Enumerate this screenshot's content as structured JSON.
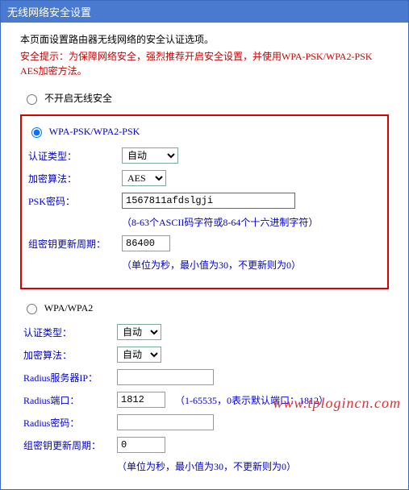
{
  "header": {
    "title": "无线网络安全设置"
  },
  "intro": "本页面设置路由器无线网络的安全认证选项。",
  "warning": "安全提示：为保障网络安全，强烈推荐开启安全设置，并使用WPA-PSK/WPA2-PSK AES加密方法。",
  "noSecurity": {
    "label": "不开启无线安全",
    "checked": false
  },
  "wpaPsk": {
    "label": "WPA-PSK/WPA2-PSK",
    "checked": true,
    "authType": {
      "label": "认证类型：",
      "value": "自动",
      "options": [
        "自动"
      ]
    },
    "encryption": {
      "label": "加密算法：",
      "value": "AES",
      "options": [
        "AES"
      ]
    },
    "pskKey": {
      "label": "PSK密码：",
      "value": "1567811afdslgji",
      "hint": "（8-63个ASCII码字符或8-64个十六进制字符）"
    },
    "groupKey": {
      "label": "组密钥更新周期：",
      "value": "86400",
      "hint": "（单位为秒，最小值为30，不更新则为0）"
    }
  },
  "wpa": {
    "label": "WPA/WPA2",
    "checked": false,
    "authType": {
      "label": "认证类型：",
      "value": "自动",
      "options": [
        "自动"
      ]
    },
    "encryption": {
      "label": "加密算法：",
      "value": "自动",
      "options": [
        "自动"
      ]
    },
    "radiusIp": {
      "label": "Radius服务器IP：",
      "value": ""
    },
    "radiusPort": {
      "label": "Radius端口：",
      "value": "1812",
      "hint": "（1-65535，0表示默认端口：1812）"
    },
    "radiusPwd": {
      "label": "Radius密码：",
      "value": ""
    },
    "groupKey": {
      "label": "组密钥更新周期：",
      "value": "0",
      "hint": "（单位为秒，最小值为30，不更新则为0）"
    }
  },
  "watermark": "www.tplogincn.com"
}
